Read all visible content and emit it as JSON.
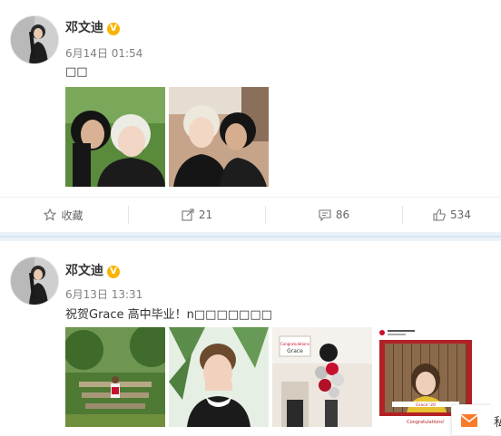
{
  "posts": [
    {
      "author": "邓文迪",
      "verified_badge": "V",
      "time": "6月14日 01:54",
      "text": "□□",
      "actions": {
        "favorite": "收藏",
        "repost": "21",
        "comment": "86",
        "like": "534"
      }
    },
    {
      "author": "邓文迪",
      "verified_badge": "V",
      "time": "6月13日 13:31",
      "text": "祝贺Grace 高中毕业！n□□□□□□□",
      "cap_2_hdr": "Congratulations",
      "cap_2_name": "Grace",
      "cap_3_name": "Grace '20",
      "cap_3_ribbon": "Congratulations!"
    }
  ],
  "side_tab": {
    "icon": "mail-icon",
    "label": "私"
  }
}
